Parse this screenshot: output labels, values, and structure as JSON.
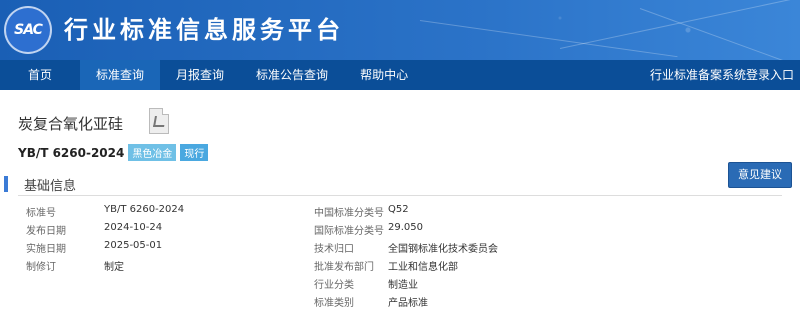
{
  "header": {
    "logo_text": "SAC",
    "title": "行业标准信息服务平台"
  },
  "nav": {
    "items": [
      {
        "label": "首页"
      },
      {
        "label": "标准查询",
        "active": true
      },
      {
        "label": "月报查询"
      },
      {
        "label": "标准公告查询"
      },
      {
        "label": "帮助中心"
      }
    ],
    "right_link": "行业标准备案系统登录入口"
  },
  "standard": {
    "name": "炭复合氧化亚硅",
    "code": "YB/T 6260-2024",
    "category_tag": "黑色冶金",
    "status_tag": "现行",
    "feedback_button": "意见建议"
  },
  "section": {
    "title": "基础信息"
  },
  "info": {
    "left": [
      {
        "label": "标准号",
        "value": "YB/T 6260-2024"
      },
      {
        "label": "发布日期",
        "value": "2024-10-24"
      },
      {
        "label": "实施日期",
        "value": "2025-05-01"
      },
      {
        "label": "制修订",
        "value": "制定"
      }
    ],
    "right": [
      {
        "label": "中国标准分类号",
        "value": "Q52"
      },
      {
        "label": "国际标准分类号",
        "value": "29.050"
      },
      {
        "label": "技术归口",
        "value": "全国钢标准化技术委员会"
      },
      {
        "label": "批准发布部门",
        "value": "工业和信息化部"
      },
      {
        "label": "行业分类",
        "value": "制造业"
      },
      {
        "label": "标准类别",
        "value": "产品标准"
      }
    ]
  },
  "colors": {
    "banner": "#1f63b9",
    "nav": "#0b4e98",
    "nav_active": "#1a66b7",
    "accent": "#3b7bd6"
  }
}
